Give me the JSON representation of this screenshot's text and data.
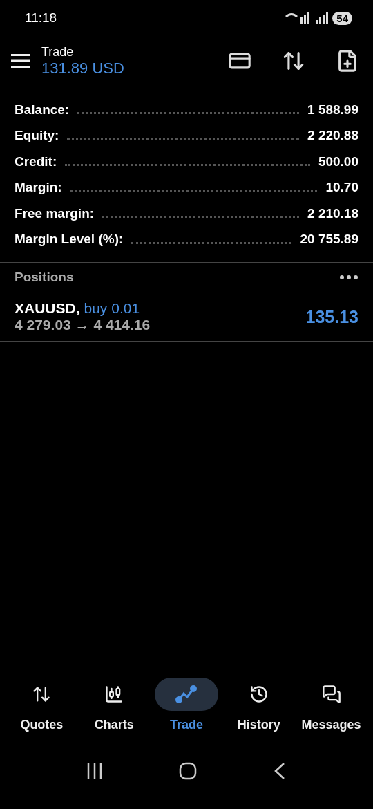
{
  "status_bar": {
    "time": "11:18",
    "battery": "54"
  },
  "header": {
    "title": "Trade",
    "subtitle": "131.89 USD"
  },
  "summary": [
    {
      "label": "Balance:",
      "value": "1 588.99"
    },
    {
      "label": "Equity:",
      "value": "2 220.88"
    },
    {
      "label": "Credit:",
      "value": "500.00"
    },
    {
      "label": "Margin:",
      "value": "10.70"
    },
    {
      "label": "Free margin:",
      "value": "2 210.18"
    },
    {
      "label": "Margin Level (%):",
      "value": "20 755.89"
    }
  ],
  "positions": {
    "title": "Positions",
    "items": [
      {
        "symbol": "XAUUSD,",
        "side": "buy 0.01",
        "prices": "4 279.03 → 4 414.16",
        "profit": "135.13"
      }
    ]
  },
  "nav": [
    {
      "label": "Quotes",
      "kind": "quotes",
      "selected": false
    },
    {
      "label": "Charts",
      "kind": "charts",
      "selected": false
    },
    {
      "label": "Trade",
      "kind": "trade",
      "selected": true
    },
    {
      "label": "History",
      "kind": "history",
      "selected": false
    },
    {
      "label": "Messages",
      "kind": "messages",
      "selected": false
    }
  ]
}
